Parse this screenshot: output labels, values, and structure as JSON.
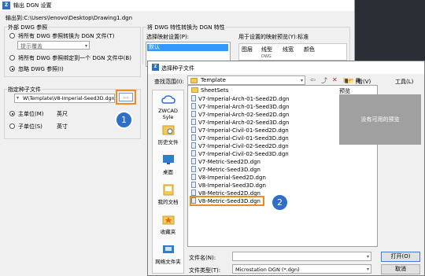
{
  "export_window": {
    "title": "输出 DGN 设置",
    "output_path": "输出到:C:\\Users\\lenovo\\Desktop\\Drawing1.dgn",
    "external_refs_group": "外部 DWG 参照",
    "radio_convert": "将所有 DWG 参照转换为 DGN 文件(T)",
    "prompt_combo": "提示覆盖",
    "radio_bind": "将所有 DWG 参照绑定到一个 DGN 文件中(B)",
    "radio_ignore": "忽略 DWG 参照(I)",
    "seed_group": "指定种子文件",
    "seed_path": "W\\Template\\V8-Imperial-Seed3D.dgn",
    "browse_label": "...",
    "radio_main_unit": "主单位(M)",
    "main_unit_value": "英尺",
    "radio_sub_unit": "子单位(S)",
    "sub_unit_value": "英寸",
    "layer_convert_title": "将 DWG 特性转换为 DGN 特性",
    "mapping_label": "选择映射设置(P):",
    "mapping_item": "默认",
    "preview_label": "用于设置的映射预览(Y):标准",
    "preview_tabs": [
      "图层",
      "线型",
      "线宽",
      "颜色"
    ],
    "preview_header": "DWG"
  },
  "file_dialog": {
    "title": "选择种子文件",
    "lookin_label": "查找范围(I):",
    "lookin_value": "Template",
    "view_label": "查看(V)",
    "tools_label": "工具(L)",
    "preview_title": "预览",
    "preview_text": "没有可用的预览",
    "places": [
      "ZWCAD Syle",
      "历史文件",
      "桌面",
      "我的文档",
      "收藏夹",
      "网络文件夹"
    ],
    "files": [
      {
        "name": "SheetSets",
        "folder": true
      },
      {
        "name": "V7-Imperial-Arch-01-Seed2D.dgn",
        "folder": false
      },
      {
        "name": "V7-Imperial-Arch-01-Seed3D.dgn",
        "folder": false
      },
      {
        "name": "V7-Imperial-Arch-02-Seed2D.dgn",
        "folder": false
      },
      {
        "name": "V7-Imperial-Arch-02-Seed3D.dgn",
        "folder": false
      },
      {
        "name": "V7-Imperial-Civil-01-Seed2D.dgn",
        "folder": false
      },
      {
        "name": "V7-Imperial-Civil-01-Seed3D.dgn",
        "folder": false
      },
      {
        "name": "V7-Imperial-Civil-02-Seed2D.dgn",
        "folder": false
      },
      {
        "name": "V7-Imperial-Civil-02-Seed3D.dgn",
        "folder": false
      },
      {
        "name": "V7-Metric-Seed2D.dgn",
        "folder": false
      },
      {
        "name": "V7-Metric-Seed3D.dgn",
        "folder": false
      },
      {
        "name": "V8-Imperial-Seed2D.dgn",
        "folder": false
      },
      {
        "name": "V8-Imperial-Seed3D.dgn",
        "folder": false
      },
      {
        "name": "V8-Metric-Seed2D.dgn",
        "folder": false
      },
      {
        "name": "V8-Metric-Seed3D.dgn",
        "folder": false
      }
    ],
    "filename_label": "文件名(N):",
    "filename_value": "",
    "filetype_label": "文件类型(T):",
    "filetype_value": "Microstation DGN (*.dgn)",
    "open_label": "打开(O)",
    "cancel_label": "取消"
  },
  "annotations": {
    "step1": "1",
    "step2": "2"
  },
  "colors": {
    "accent": "#f08b1e",
    "badge": "#2f6fc6"
  }
}
